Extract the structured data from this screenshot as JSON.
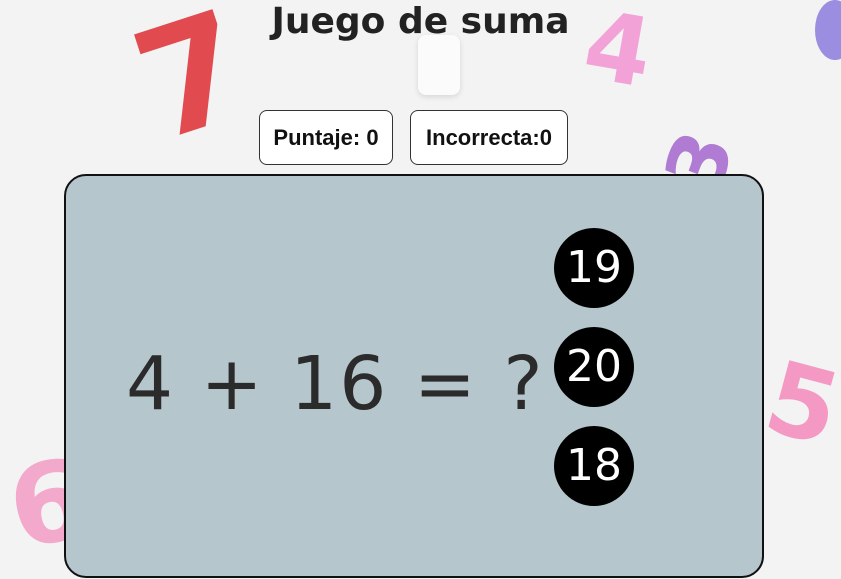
{
  "title": "Juego de suma",
  "score": {
    "label": "Puntaje: 0"
  },
  "wrong": {
    "label": "Incorrecta:0"
  },
  "question": {
    "text": "4 + 16 = ?"
  },
  "options": [
    "19",
    "20",
    "18"
  ],
  "background_toys": [
    {
      "glyph": "7",
      "color": "#e0393e"
    },
    {
      "glyph": "4",
      "color": "#f39ad6"
    },
    {
      "glyph": "5",
      "color": "#f58fbf"
    },
    {
      "glyph": "6",
      "color": "#f4a1c8"
    },
    {
      "glyph": "3",
      "color": "#a86fd0"
    }
  ]
}
